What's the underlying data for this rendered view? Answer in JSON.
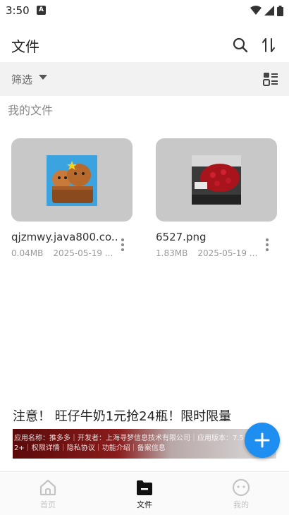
{
  "status_bar": {
    "time": "3:50",
    "notification_icon": "A"
  },
  "header": {
    "title": "文件",
    "search_icon": "search-icon",
    "sort_icon": "sort-icon"
  },
  "filter": {
    "label": "筛选"
  },
  "section": {
    "title": "我的文件"
  },
  "files": [
    {
      "name": "qjzmwy.java800.co...",
      "size": "0.04MB",
      "date": "2025-05-19 ..."
    },
    {
      "name": "6527.png",
      "size": "1.83MB",
      "date": "2025-05-19 ..."
    }
  ],
  "ad": {
    "title": "注意！ 旺仔牛奶1元抢24瓶！限时限量",
    "line1": "应用名称：推多多｜开发者：上海寻梦信息技术有限公司｜应用版本：7.58.0｜添加",
    "line2": "2+｜权限详情｜隐私协议｜功能介绍｜备案信息"
  },
  "bottom_nav": [
    {
      "label": "首页",
      "active": false
    },
    {
      "label": "文件",
      "active": true
    },
    {
      "label": "我的",
      "active": false
    }
  ],
  "colors": {
    "accent": "#1e8ef0",
    "active_nav": "#111111",
    "inactive_nav": "#c4c4c4"
  }
}
